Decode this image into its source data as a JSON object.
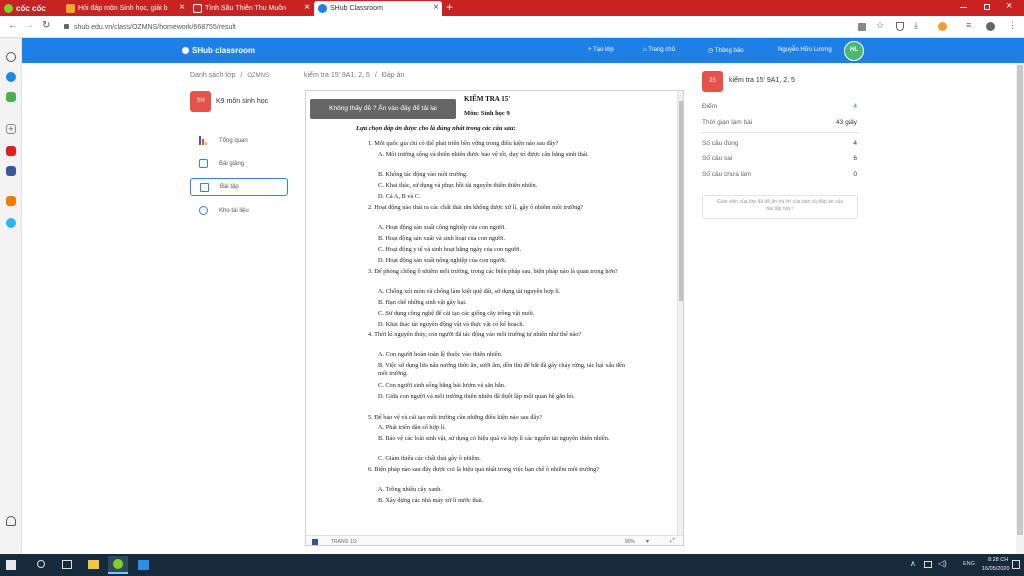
{
  "browser": {
    "brand": "cốc cốc",
    "tabs": [
      {
        "label": "Hỏi đáp môn Sinh học, giải b",
        "fav_color": "#f5a623"
      },
      {
        "label": "Tình Sâu Thiên Thu Muôn",
        "fav_color": "#e02020"
      },
      {
        "label": "SHub Classroom",
        "fav_color": "#1e7fe6"
      }
    ],
    "new_tab": "+",
    "url": "shub.edu.vn/class/OZMNS/homework/668755/result"
  },
  "header": {
    "logo": "SHub classroom",
    "nav": {
      "create": "+ Tạo lớp",
      "home": "Trang chủ",
      "notifications": "Thông báo",
      "user_name": "Nguyễn Hữu Lương",
      "avatar": "HL"
    }
  },
  "breadcrumb": {
    "class_list": "Danh sách lớp",
    "sep": "/",
    "class_code": "OZMNS",
    "test": "kiểm tra 15' 9A1, 2, 5",
    "answer": "Đáp án"
  },
  "class": {
    "badge": "SH",
    "name": "K9 môn sinh học"
  },
  "menu": [
    {
      "label": "Tổng quan"
    },
    {
      "label": "Bài giảng"
    },
    {
      "label": "Bài tập"
    },
    {
      "label": "Kho tài liệu"
    }
  ],
  "doc": {
    "overlay_notice": "Không thấy đề ? Ấn vào đây để tải lại",
    "title": "KIỂM TRA 15'",
    "subject": "Môn: Sinh học 9",
    "instruction": "Lựa chọn đáp án được cho là đúng nhất trong các câu sau:",
    "questions": [
      {
        "q": "1.  Mỗi quốc gia chỉ có thể phát triển bền vững trong điều kiện nào sau đây?",
        "opts": [
          "A.  Môi trường sống và thiên nhiên được bảo vệ tốt, duy trì được cân bằng sinh thái.",
          "B.  Không tác động vào môi trường.",
          "C.  Khai thác, sử dụng và phục hồi tài nguyên thiên thiên nhiên.",
          "D.  Cả A, B và C."
        ]
      },
      {
        "q": "2.  Hoạt động nào thải ra các chất thải rắn không được xử lí, gây ô nhiễm môi trường?",
        "opts": [
          "A.  Hoạt động sản xuất công nghiệp của con người.",
          "B.  Hoạt động sản xuất và sinh hoạt của con người.",
          "C.  Hoạt động y tế và sinh hoạt hằng ngày của con người.",
          "D.  Hoạt động sản xuất nông nghiệp của con người."
        ]
      },
      {
        "q": "3.  Để phòng chống ô nhiễm môi trường, trong các biện pháp sau, biện pháp nào là quan trọng hơn?",
        "opts": [
          "A.  Chống xói mòn và chống làm kiệt quệ đất, sử dụng tài nguyên hợp lí.",
          "B.  Hạn chế những sinh vật gây hại.",
          "C.  Sử dụng công nghệ để cải tạo các giống cây trồng vật nuôi.",
          "D.  Khai thác tài nguyên động vật và thực vật có kế hoạch."
        ]
      },
      {
        "q": "4.  Thời kì nguyên thủy, con người đã tác động vào môi trường tự nhiên như thế nào?",
        "opts": [
          "A.  Con người hoàn toàn lệ thuộc vào thiên nhiên.",
          "B.  Việc sử dụng lửa nấu nướng thức ăn, sưởi ấm, dồn thú để bắt đã gây cháy rừng, tác hại xấu đến môi trường.",
          "C.  Con người sinh sống bằng hái lượm và săn bắn.",
          "D.  Giữa con người và môi trường thiên nhiên đã thiết lập mối quan hệ gắn bó."
        ]
      },
      {
        "q": "5.  Để bảo vệ và cải tạo môi trường cần những điều kiện nào sau đây?",
        "opts": [
          "A.  Phát triển dân số hợp lí.",
          "B.  Bảo vệ các loài sinh vật, sử dụng có hiệu quả và hợp lí các nguồn tài nguyên thiên nhiên.",
          "C.  Giảm thiểu các chất thải gây ô nhiễm."
        ]
      },
      {
        "q": "6.  Biện pháp nào sau đây được coi là hiệu quả nhất trong việc hạn chế ô nhiễm môi trường?",
        "opts": [
          "A.  Trồng nhiều cây xanh.",
          "B.  Xây dựng các nhà máy xử lí nước thải."
        ]
      }
    ],
    "footer_page": "TRANG 1/2",
    "footer_zoom": "80%"
  },
  "result": {
    "badge": "25",
    "title": "kiểm tra 15' 9A1, 2, 5",
    "stats": [
      {
        "label": "Điểm",
        "value": "4"
      },
      {
        "label": "Thời gian làm bài",
        "value": "43 giây"
      },
      {
        "label": "Số câu đúng",
        "value": "4"
      },
      {
        "label": "Số câu sai",
        "value": "6"
      },
      {
        "label": "Số câu chưa làm",
        "value": "0"
      }
    ],
    "note": "Giáo viên của lớp đã để ẩn trả lời của bạn và đáp án của bài tập này !"
  },
  "taskbar": {
    "lang": "ENG",
    "time": "8:28 CH",
    "date": "16/05/2020"
  },
  "colors": {
    "brand": "#1e7fe6",
    "browser_red": "#c82322",
    "taskbar": "#172a3b",
    "badge_red": "#e8504a"
  }
}
